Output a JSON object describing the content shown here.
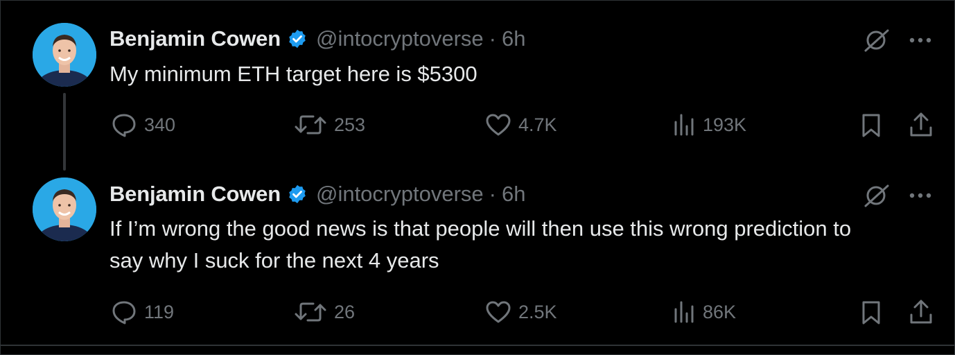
{
  "tweets": [
    {
      "author": "Benjamin Cowen",
      "handle": "@intocryptoverse",
      "separator": "·",
      "time": "6h",
      "text": "My minimum ETH target here is $5300",
      "replies": "340",
      "reposts": "253",
      "likes": "4.7K",
      "views": "193K"
    },
    {
      "author": "Benjamin Cowen",
      "handle": "@intocryptoverse",
      "separator": "·",
      "time": "6h",
      "text": "If I’m wrong the good news is that people will then use this wrong prediction to say why I suck for the next 4 years",
      "replies": "119",
      "reposts": "26",
      "likes": "2.5K",
      "views": "86K"
    }
  ],
  "icons": {
    "verified": "verified-badge-icon",
    "grok": "grok-icon",
    "more": "more-icon",
    "reply": "reply-icon",
    "repost": "repost-icon",
    "like": "like-icon",
    "views": "views-icon",
    "bookmark": "bookmark-icon",
    "share": "share-icon"
  },
  "colors": {
    "background": "#000000",
    "text": "#e7e9ea",
    "muted": "#71767b",
    "verified": "#1d9bf0",
    "divider": "#2f3336"
  }
}
